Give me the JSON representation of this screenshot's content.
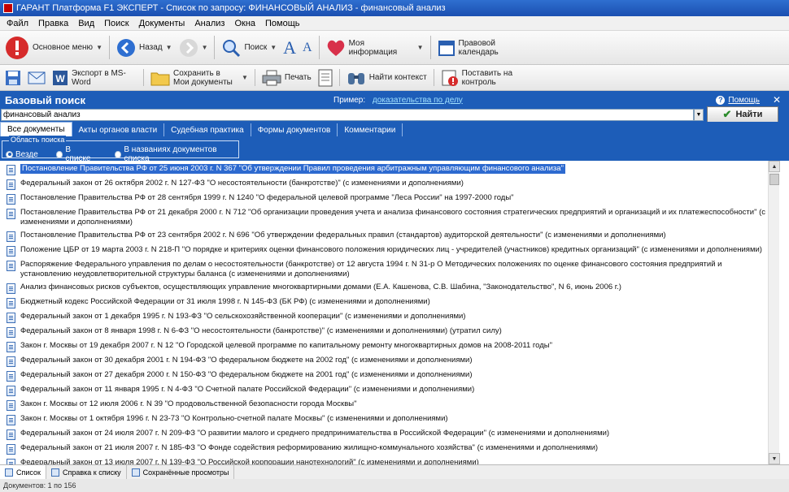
{
  "window": {
    "title": "ГАРАНТ Платформа F1 ЭКСПЕРТ - Список по запросу: ФИНАНСОВЫЙ АНАЛИЗ - финансовый анализ"
  },
  "menu": [
    "Файл",
    "Правка",
    "Вид",
    "Поиск",
    "Документы",
    "Анализ",
    "Окна",
    "Помощь"
  ],
  "toolbar1": {
    "main_menu": "Основное меню",
    "back": "Назад",
    "search": "Поиск",
    "my_info": "Моя информация",
    "legal_calendar": "Правовой календарь"
  },
  "toolbar2": {
    "export_word": "Экспорт в MS-Word",
    "save_to_my_docs": "Сохранить в Мои документы",
    "print": "Печать",
    "find_context": "Найти контекст",
    "put_on_control": "Поставить на контроль"
  },
  "search": {
    "title": "Базовый поиск",
    "example_label": "Пример:",
    "example_link": "доказательства по делу",
    "help": "Помощь",
    "query": "финансовый анализ",
    "find_button": "Найти"
  },
  "tabs": [
    "Все документы",
    "Акты органов власти",
    "Судебная практика",
    "Формы документов",
    "Комментарии"
  ],
  "area": {
    "legend": "Область поиска",
    "options": [
      "Везде",
      "В списке",
      "В названиях документов списка"
    ]
  },
  "results": [
    "Постановление Правительства РФ от 25 июня 2003 г. N 367 \"Об утверждении Правил проведения арбитражным управляющим финансового анализа\"",
    "Федеральный закон от 26 октября 2002 г. N 127-ФЗ \"О несостоятельности (банкротстве)\" (с изменениями и дополнениями)",
    "Постановление Правительства РФ от 28 сентября 1999 г. N 1240 \"О федеральной целевой программе \"Леса России\" на 1997-2000 годы\"",
    "Постановление Правительства РФ от 21 декабря 2000 г. N 712 \"Об организации проведения учета и анализа финансового состояния стратегических предприятий и организаций и их платежеспособности\" (с изменениями и дополнениями)",
    "Постановление Правительства РФ от 23 сентября 2002 г. N 696 \"Об утверждении федеральных правил (стандартов) аудиторской деятельности\" (с изменениями и дополнениями)",
    "Положение ЦБР от 19 марта 2003 г. N 218-П \"О порядке и критериях оценки финансового положения юридических лиц - учредителей (участников) кредитных организаций\" (с изменениями и дополнениями)",
    "Распоряжение Федерального управления по делам о несостоятельности (банкротстве) от 12 августа 1994 г. N 31-р О Методических положениях по оценке финансового состояния предприятий и установлению неудовлетворительной структуры баланса (с изменениями и дополнениями)",
    "Анализ финансовых рисков субъектов, осуществляющих управление многоквартирными домами (Е.А. Кашенова, С.В. Шабина, \"Законодательство\", N 6, июнь 2006 г.)",
    "Бюджетный кодекс Российской Федерации от 31 июля 1998 г. N 145-ФЗ (БК РФ) (с изменениями и дополнениями)",
    "Федеральный закон от 1 декабря 1995 г. N 193-ФЗ \"О сельскохозяйственной кооперации\" (с изменениями и дополнениями)",
    "Федеральный закон от 8 января 1998 г. N 6-ФЗ \"О несостоятельности (банкротстве)\" (с изменениями и дополнениями) (утратил силу)",
    "Закон г. Москвы от 19 декабря 2007 г. N 12 \"О Городской целевой программе по капитальному ремонту многоквартирных домов на 2008-2011 годы\"",
    "Федеральный закон от 30 декабря 2001 г. N 194-ФЗ \"О федеральном бюджете на 2002 год\" (с изменениями и дополнениями)",
    "Федеральный закон от 27 декабря 2000 г. N 150-ФЗ \"О федеральном бюджете на 2001 год\" (с изменениями и дополнениями)",
    "Федеральный закон от 11 января 1995 г. N 4-ФЗ \"О Счетной палате Российской Федерации\" (с изменениями и дополнениями)",
    "Закон г. Москвы от 12 июля 2006 г. N 39 \"О продовольственной безопасности города Москвы\"",
    "Закон г. Москвы от 1 октября 1996 г. N 23-73 \"О Контрольно-счетной палате Москвы\" (с изменениями и дополнениями)",
    "Федеральный закон от 24 июля 2007 г. N 209-ФЗ \"О развитии малого и среднего предпринимательства в Российской Федерации\" (с изменениями и дополнениями)",
    "Федеральный закон от 21 июля 2007 г. N 185-ФЗ \"О Фонде содействия реформированию жилищно-коммунального хозяйства\" (с изменениями и дополнениями)",
    "Федеральный закон от 13 июля 2007 г. N 139-ФЗ \"О Российской корпорации нанотехнологий\" (с изменениями и дополнениями)"
  ],
  "bottom_tabs": [
    "Список",
    "Справка к списку",
    "Сохранённые просмотры"
  ],
  "status": "Документов: 1 по 156",
  "colors": {
    "accent": "#1d5db8",
    "selection": "#2d6ad0",
    "titlebar": "#1b4fb0"
  }
}
